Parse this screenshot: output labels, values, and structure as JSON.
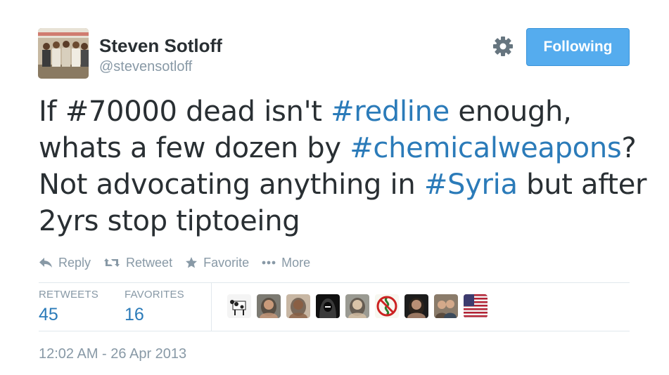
{
  "user": {
    "name": "Steven Sotloff",
    "handle": "@stevensotloff",
    "follow_label": "Following"
  },
  "tweet": {
    "lines": [
      [
        {
          "text": "If #70000 dead isn't ",
          "tag": false
        },
        {
          "text": "#redline",
          "tag": true
        },
        {
          "text": " enough,",
          "tag": false
        }
      ],
      [
        {
          "text": "whats a few dozen by ",
          "tag": false
        },
        {
          "text": "#chemicalweapons",
          "tag": true
        },
        {
          "text": "?",
          "tag": false
        }
      ],
      [
        {
          "text": "Not advocating anything in ",
          "tag": false
        },
        {
          "text": "#Syria",
          "tag": true
        },
        {
          "text": " but after",
          "tag": false
        }
      ],
      [
        {
          "text": "2yrs stop tiptoeing",
          "tag": false
        }
      ]
    ]
  },
  "actions": {
    "reply": "Reply",
    "retweet": "Retweet",
    "favorite": "Favorite",
    "more": "More"
  },
  "stats": {
    "retweets_label": "RETWEETS",
    "retweets_count": "45",
    "favorites_label": "FAVORITES",
    "favorites_count": "16"
  },
  "timestamp": "12:02 AM - 26 Apr 2013",
  "favoriters": [
    {
      "icon": "cow-avatar",
      "bg": "#f4f4f4",
      "fg": "#222222"
    },
    {
      "icon": "woman-avatar",
      "bg": "#7c7a72",
      "fg": "#c99a7a"
    },
    {
      "icon": "woman-avatar",
      "bg": "#c8b7a4",
      "fg": "#8a5f44"
    },
    {
      "icon": "hooded-avatar",
      "bg": "#101010",
      "fg": "#3a3a3a"
    },
    {
      "icon": "woman-avatar",
      "bg": "#9a9a92",
      "fg": "#d9c3a8"
    },
    {
      "icon": "no-snake-avatar",
      "bg": "#f7f7f0",
      "fg": "#2e7d2e"
    },
    {
      "icon": "woman-avatar",
      "bg": "#1c1c1c",
      "fg": "#b98f75"
    },
    {
      "icon": "couple-avatar",
      "bg": "#8a7b6a",
      "fg": "#d4a98a"
    },
    {
      "icon": "us-flag-avatar",
      "bg": "#b22234",
      "fg": "#3c3b6e"
    }
  ],
  "colors": {
    "link": "#2b7bb9",
    "follow_button": "#55acee",
    "muted": "#8899a6",
    "text": "#292f33"
  }
}
